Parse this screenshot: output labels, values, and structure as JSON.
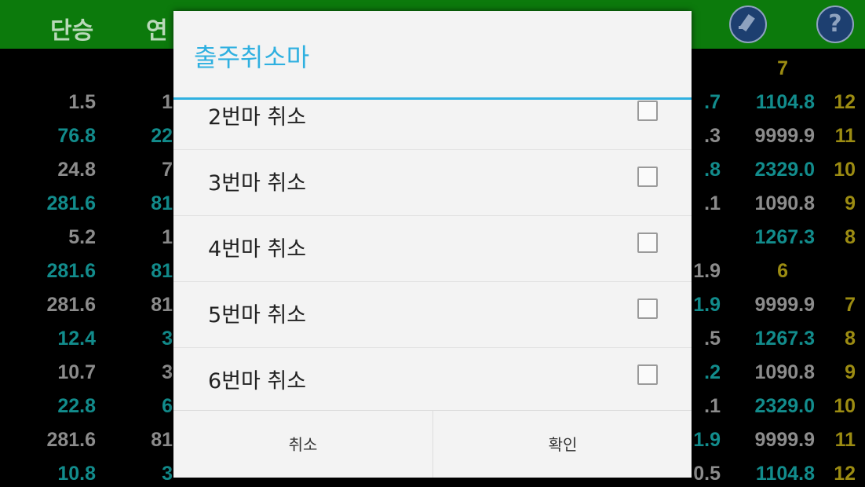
{
  "header": {
    "col1": "단승",
    "col2": "연"
  },
  "icons": {
    "edit": "edit-icon",
    "help": "help-icon"
  },
  "background_rows": [
    {
      "left": "",
      "left_color": "gray",
      "mid": "",
      "right": "",
      "right_color": "gray",
      "far": "7"
    },
    {
      "left": "1.5",
      "left_color": "gray",
      "mid": "1",
      "right": "1104.8",
      "right_color": "teal",
      "far": "12"
    },
    {
      "left": "76.8",
      "left_color": "teal",
      "mid": "22",
      "right": "9999.9",
      "right_color": "gray",
      "far": "11"
    },
    {
      "left": "24.8",
      "left_color": "gray",
      "mid": "7",
      "right": "2329.0",
      "right_color": "teal",
      "far": "10"
    },
    {
      "left": "281.6",
      "left_color": "teal",
      "mid": "81",
      "right": "1090.8",
      "right_color": "gray",
      "far": "9"
    },
    {
      "left": "5.2",
      "left_color": "gray",
      "mid": "1",
      "right": "1267.3",
      "right_color": "teal",
      "far": "8"
    },
    {
      "left": "281.6",
      "left_color": "teal",
      "mid": "81",
      "right": "",
      "right_color": "gray",
      "far": "6"
    },
    {
      "left": "281.6",
      "left_color": "gray",
      "mid": "81",
      "right": "9999.9",
      "right_color": "gray",
      "far": "7"
    },
    {
      "left": "12.4",
      "left_color": "teal",
      "mid": "3",
      "right": "1267.3",
      "right_color": "teal",
      "far": "8"
    },
    {
      "left": "10.7",
      "left_color": "gray",
      "mid": "3",
      "right": "1090.8",
      "right_color": "gray",
      "far": "9"
    },
    {
      "left": "22.8",
      "left_color": "teal",
      "mid": "6",
      "right": "2329.0",
      "right_color": "teal",
      "far": "10"
    },
    {
      "left": "281.6",
      "left_color": "gray",
      "mid": "81",
      "right": "9999.9",
      "right_color": "gray",
      "far": "11"
    },
    {
      "left": "10.8",
      "left_color": "teal",
      "mid": "3",
      "right": "1104.8",
      "right_color": "teal",
      "far": "12"
    }
  ],
  "partial_col": [
    ".7",
    ".3",
    ".8",
    ".1",
    "",
    "1.9",
    "1.9",
    ".5",
    ".2",
    ".1",
    "1.9",
    "0.5"
  ],
  "dialog": {
    "title": "출주취소마",
    "items": [
      {
        "label": "2번마 취소",
        "checked": false
      },
      {
        "label": "3번마 취소",
        "checked": false
      },
      {
        "label": "4번마 취소",
        "checked": false
      },
      {
        "label": "5번마 취소",
        "checked": false
      },
      {
        "label": "6번마 취소",
        "checked": false
      }
    ],
    "cancel_label": "취소",
    "confirm_label": "확인"
  }
}
